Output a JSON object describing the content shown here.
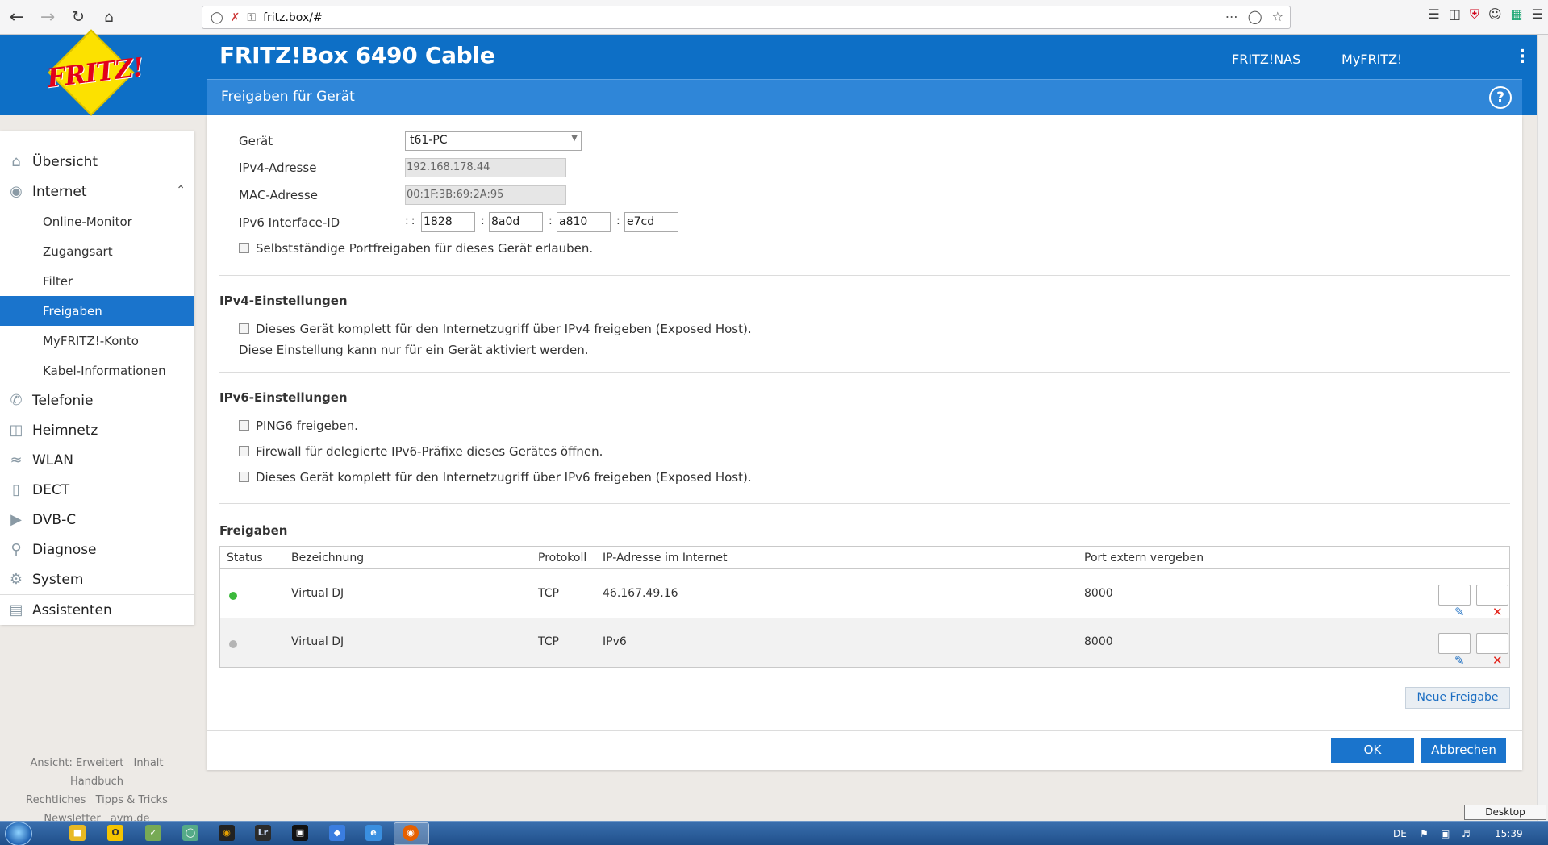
{
  "browser": {
    "url": "fritz.box/#"
  },
  "header": {
    "logo_text": "FRITZ!",
    "device_title": "FRITZ!Box 6490 Cable",
    "link_nas": "FRITZ!NAS",
    "link_myfritz": "MyFRITZ!",
    "page_title": "Freigaben für Gerät",
    "help_label": "?"
  },
  "sidebar": {
    "items": [
      {
        "label": "Übersicht",
        "icon": "home-icon"
      },
      {
        "label": "Internet",
        "icon": "globe-icon"
      },
      {
        "label": "Telefonie",
        "icon": "phone-icon"
      },
      {
        "label": "Heimnetz",
        "icon": "network-icon"
      },
      {
        "label": "WLAN",
        "icon": "wifi-icon"
      },
      {
        "label": "DECT",
        "icon": "dect-icon"
      },
      {
        "label": "DVB-C",
        "icon": "tv-icon"
      },
      {
        "label": "Diagnose",
        "icon": "diagnose-icon"
      },
      {
        "label": "System",
        "icon": "system-icon"
      },
      {
        "label": "Assistenten",
        "icon": "assistant-icon"
      }
    ],
    "internet_sub": [
      "Online-Monitor",
      "Zugangsart",
      "Filter",
      "Freigaben",
      "MyFRITZ!-Konto",
      "Kabel-Informationen"
    ],
    "active_sub": "Freigaben",
    "footer": {
      "row1": [
        "Ansicht: Erweitert",
        "Inhalt",
        "Handbuch"
      ],
      "row2": [
        "Rechtliches",
        "Tipps & Tricks"
      ],
      "row3": [
        "Newsletter",
        "avm.de"
      ]
    }
  },
  "form": {
    "geraet_label": "Gerät",
    "geraet_value": "t61-PC",
    "ipv4_label": "IPv4-Adresse",
    "ipv4_value": "192.168.178.44",
    "mac_label": "MAC-Adresse",
    "mac_value": "00:1F:3B:69:2A:95",
    "ipv6_label": "IPv6 Interface-ID",
    "ipv6_prefix": "::",
    "ipv6_parts": [
      "1828",
      "8a0d",
      "a810",
      "e7cd"
    ],
    "self_port_label": "Selbstständige Portfreigaben für dieses Gerät erlauben."
  },
  "ipv4_section": {
    "heading": "IPv4-Einstellungen",
    "exposed_label": "Dieses Gerät komplett für den Internetzugriff über IPv4 freigeben (Exposed Host).",
    "note": "Diese Einstellung kann nur für ein Gerät aktiviert werden."
  },
  "ipv6_section": {
    "heading": "IPv6-Einstellungen",
    "ping6_label": "PING6 freigeben.",
    "firewall_label": "Firewall für delegierte IPv6-Präfixe dieses Gerätes öffnen.",
    "exposed_label": "Dieses Gerät komplett für den Internetzugriff über IPv6 freigeben (Exposed Host)."
  },
  "freigaben": {
    "heading": "Freigaben",
    "columns": [
      "Status",
      "Bezeichnung",
      "Protokoll",
      "IP-Adresse im Internet",
      "Port extern vergeben"
    ],
    "rows": [
      {
        "status_color": "#3cb93c",
        "bezeichnung": "Virtual DJ",
        "protokoll": "TCP",
        "ip": "46.167.49.16",
        "port": "8000"
      },
      {
        "status_color": "#b5b5b5",
        "bezeichnung": "Virtual DJ",
        "protokoll": "TCP",
        "ip": "IPv6",
        "port": "8000"
      }
    ],
    "new_button": "Neue Freigabe"
  },
  "actions": {
    "ok": "OK",
    "cancel": "Abbrechen"
  },
  "taskbar": {
    "lang": "DE",
    "time": "15:39",
    "tooltip": "Desktop anzeigen"
  },
  "colors": {
    "brand_blue": "#0d6fc6",
    "active_blue": "#1a74cc"
  }
}
